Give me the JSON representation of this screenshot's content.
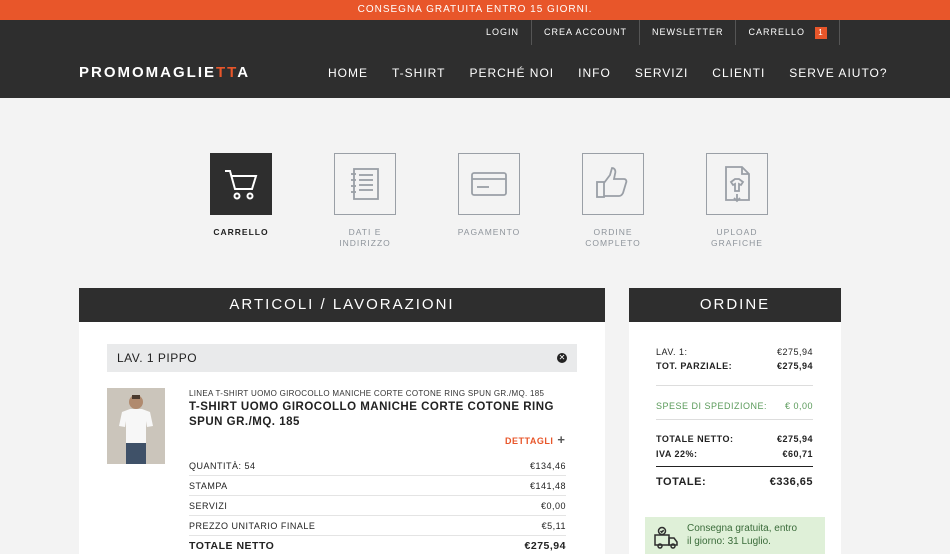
{
  "promo": "CONSEGNA GRATUITA ENTRO 15 GIORNI.",
  "util_nav": {
    "login": "LOGIN",
    "crea_account": "CREA ACCOUNT",
    "newsletter": "NEWSLETTER",
    "carrello": "CARRELLO",
    "cart_count": "1"
  },
  "logo": {
    "before": "PROMOMAGLIE",
    "accent": "TT",
    "after": "A"
  },
  "main_nav": [
    "HOME",
    "T-SHIRT",
    "PERCHÉ NOI",
    "INFO",
    "SERVIZI",
    "CLIENTI",
    "SERVE AIUTO?"
  ],
  "steps": [
    {
      "label": "CARRELLO",
      "icon": "cart-icon",
      "active": true
    },
    {
      "label": "DATI E INDIRIZZO",
      "icon": "notebook-icon",
      "active": false
    },
    {
      "label": "PAGAMENTO",
      "icon": "credit-card-icon",
      "active": false
    },
    {
      "label": "ORDINE COMPLETO",
      "icon": "thumbs-up-icon",
      "active": false
    },
    {
      "label": "UPLOAD GRAFICHE",
      "icon": "upload-file-icon",
      "active": false
    }
  ],
  "articles": {
    "header": "ARTICOLI / LAVORAZIONI",
    "lav_title": "LAV. 1 PIPPO",
    "product_sub": "LINEA T-SHIRT UOMO GIROCOLLO MANICHE CORTE COTONE RING SPUN GR./MQ. 185",
    "product_title": "T-SHIRT UOMO GIROCOLLO MANICHE CORTE COTONE RING SPUN GR./MQ. 185",
    "details": "DETTAGLI",
    "rows": [
      {
        "label": "QUANTITÀ: 54",
        "value": "€134,46"
      },
      {
        "label": "STAMPA",
        "value": "€141,48"
      },
      {
        "label": "SERVIZI",
        "value": "€0,00"
      },
      {
        "label": "PREZZO UNITARIO FINALE",
        "value": "€5,11"
      },
      {
        "label": "TOTALE NETTO",
        "value": "€275,94"
      }
    ]
  },
  "order": {
    "header": "ORDINE",
    "lav_label": "LAV. 1:",
    "lav_value": "€275,94",
    "parziale_label": "TOT. PARZIALE:",
    "parziale_value": "€275,94",
    "spese_label": "SPESE DI SPEDIZIONE:",
    "spese_value": "€ 0,00",
    "netto_label": "TOTALE NETTO:",
    "netto_value": "€275,94",
    "iva_label": "IVA 22%:",
    "iva_value": "€60,71",
    "totale_label": "TOTALE:",
    "totale_value": "€336,65",
    "delivery_line1": "Consegna gratuita, entro",
    "delivery_line2": "il giorno: 31 Luglio."
  },
  "colors": {
    "accent": "#e8562a",
    "dark": "#2e2e2e",
    "success_bg": "#dff0d8"
  }
}
